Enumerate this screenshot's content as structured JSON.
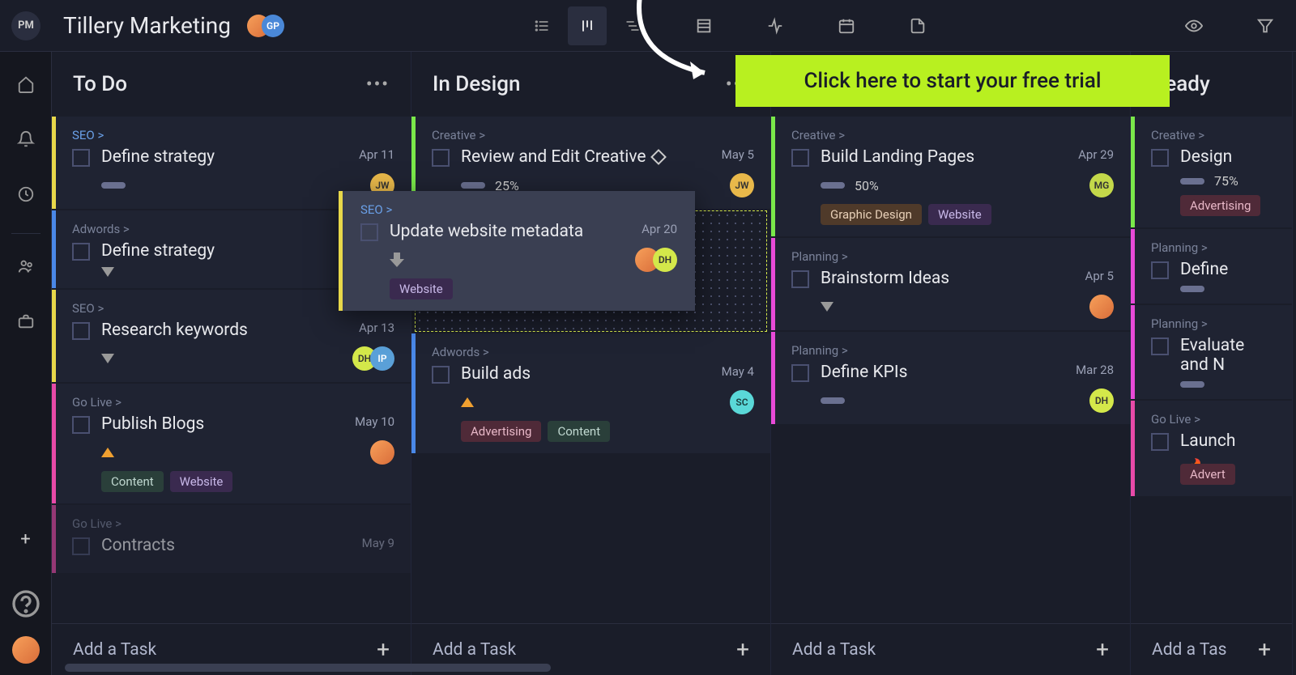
{
  "header": {
    "logo": "PM",
    "title": "Tillery Marketing",
    "avatars": [
      {
        "cls": "img",
        "label": ""
      },
      {
        "cls": "gp",
        "label": "GP"
      }
    ]
  },
  "cta": "Click here to start your free trial",
  "columns": [
    {
      "title": "To Do",
      "cards": [
        {
          "color": "yellow",
          "crumb": "SEO >",
          "crumbHl": true,
          "title": "Define strategy",
          "date": "Apr 11",
          "progress": null,
          "progressPct": "",
          "priority": "bar",
          "avatars": [
            {
              "cls": "jw",
              "label": "JW"
            }
          ],
          "tags": []
        },
        {
          "color": "blue",
          "crumb": "Adwords >",
          "crumbHl": false,
          "title": "Define strategy",
          "date": "",
          "progress": null,
          "progressPct": "",
          "priority": "down",
          "avatars": [],
          "tags": []
        },
        {
          "color": "yellow",
          "crumb": "SEO >",
          "crumbHl": false,
          "title": "Research keywords",
          "date": "Apr 13",
          "progress": null,
          "progressPct": "",
          "priority": "down",
          "avatars": [
            {
              "cls": "dh",
              "label": "DH"
            },
            {
              "cls": "ip",
              "label": "IP"
            }
          ],
          "tags": []
        },
        {
          "color": "pink",
          "crumb": "Go Live >",
          "crumbHl": false,
          "title": "Publish Blogs",
          "date": "May 10",
          "progress": null,
          "progressPct": "",
          "priority": "up",
          "avatars": [
            {
              "cls": "img",
              "label": ""
            }
          ],
          "tags": [
            {
              "cls": "content",
              "t": "Content"
            },
            {
              "cls": "website",
              "t": "Website"
            }
          ]
        },
        {
          "color": "pink",
          "crumb": "Go Live >",
          "crumbHl": false,
          "title": "Contracts",
          "date": "May 9",
          "progress": null,
          "progressPct": "",
          "priority": "",
          "avatars": [],
          "tags": [],
          "cut": true
        }
      ],
      "addTask": "Add a Task"
    },
    {
      "title": "In Design",
      "cards": [
        {
          "color": "green",
          "crumb": "Creative >",
          "crumbHl": false,
          "title": "Review and Edit Creative",
          "diamond": true,
          "date": "May 5",
          "progress": 25,
          "progressPct": "25%",
          "priority": "bar",
          "avatars": [
            {
              "cls": "jw",
              "label": "JW"
            }
          ],
          "tags": []
        },
        {
          "dropzone": true
        },
        {
          "color": "blue",
          "crumb": "Adwords >",
          "crumbHl": false,
          "title": "Build ads",
          "date": "May 4",
          "progress": null,
          "progressPct": "",
          "priority": "up",
          "avatars": [
            {
              "cls": "sc",
              "label": "SC"
            }
          ],
          "tags": [
            {
              "cls": "advertising",
              "t": "Advertising"
            },
            {
              "cls": "content",
              "t": "Content"
            }
          ]
        }
      ],
      "addTask": "Add a Task"
    },
    {
      "title": "",
      "cards": [
        {
          "color": "green",
          "crumb": "Creative >",
          "crumbHl": false,
          "title": "Build Landing Pages",
          "date": "Apr 29",
          "progress": 50,
          "progressPct": "50%",
          "priority": "bar",
          "avatars": [
            {
              "cls": "mg",
              "label": "MG"
            }
          ],
          "tags": [
            {
              "cls": "graphic",
              "t": "Graphic Design"
            },
            {
              "cls": "website",
              "t": "Website"
            }
          ]
        },
        {
          "color": "magenta",
          "crumb": "Planning >",
          "crumbHl": false,
          "title": "Brainstorm Ideas",
          "date": "Apr 5",
          "progress": null,
          "progressPct": "",
          "priority": "downfill",
          "avatars": [
            {
              "cls": "img",
              "label": ""
            }
          ],
          "tags": []
        },
        {
          "color": "magenta",
          "crumb": "Planning >",
          "crumbHl": false,
          "title": "Define KPIs",
          "date": "Mar 28",
          "progress": null,
          "progressPct": "",
          "priority": "bar",
          "avatars": [
            {
              "cls": "dh",
              "label": "DH"
            }
          ],
          "tags": []
        }
      ],
      "addTask": "Add a Task"
    },
    {
      "title": "Ready",
      "peek": true,
      "cards": [
        {
          "color": "green",
          "crumb": "Creative >",
          "crumbHl": false,
          "title": "Design",
          "date": "",
          "progress": 75,
          "progressPct": "75%",
          "priority": "bar",
          "avatars": [],
          "tags": [
            {
              "cls": "advertising",
              "t": "Advertising"
            }
          ]
        },
        {
          "color": "magenta",
          "crumb": "Planning >",
          "crumbHl": false,
          "title": "Define",
          "date": "",
          "progress": null,
          "progressPct": "",
          "priority": "bar",
          "avatars": [],
          "tags": []
        },
        {
          "color": "magenta",
          "crumb": "Planning >",
          "crumbHl": false,
          "title": "Evaluate and N",
          "date": "",
          "progress": null,
          "progressPct": "",
          "priority": "bar",
          "avatars": [],
          "tags": []
        },
        {
          "color": "pink",
          "crumb": "Go Live >",
          "crumbHl": false,
          "title": "Launch",
          "date": "",
          "progress": null,
          "progressPct": "",
          "priority": "fire",
          "avatars": [],
          "tags": [
            {
              "cls": "advertising",
              "t": "Advert"
            }
          ]
        }
      ],
      "addTask": "Add a Tas"
    }
  ],
  "dragged": {
    "crumb": "SEO >",
    "title": "Update website metadata",
    "date": "Apr 20",
    "avatars": [
      {
        "cls": "img",
        "label": ""
      },
      {
        "cls": "dh",
        "label": "DH"
      }
    ],
    "tags": [
      {
        "cls": "website",
        "t": "Website"
      }
    ]
  }
}
